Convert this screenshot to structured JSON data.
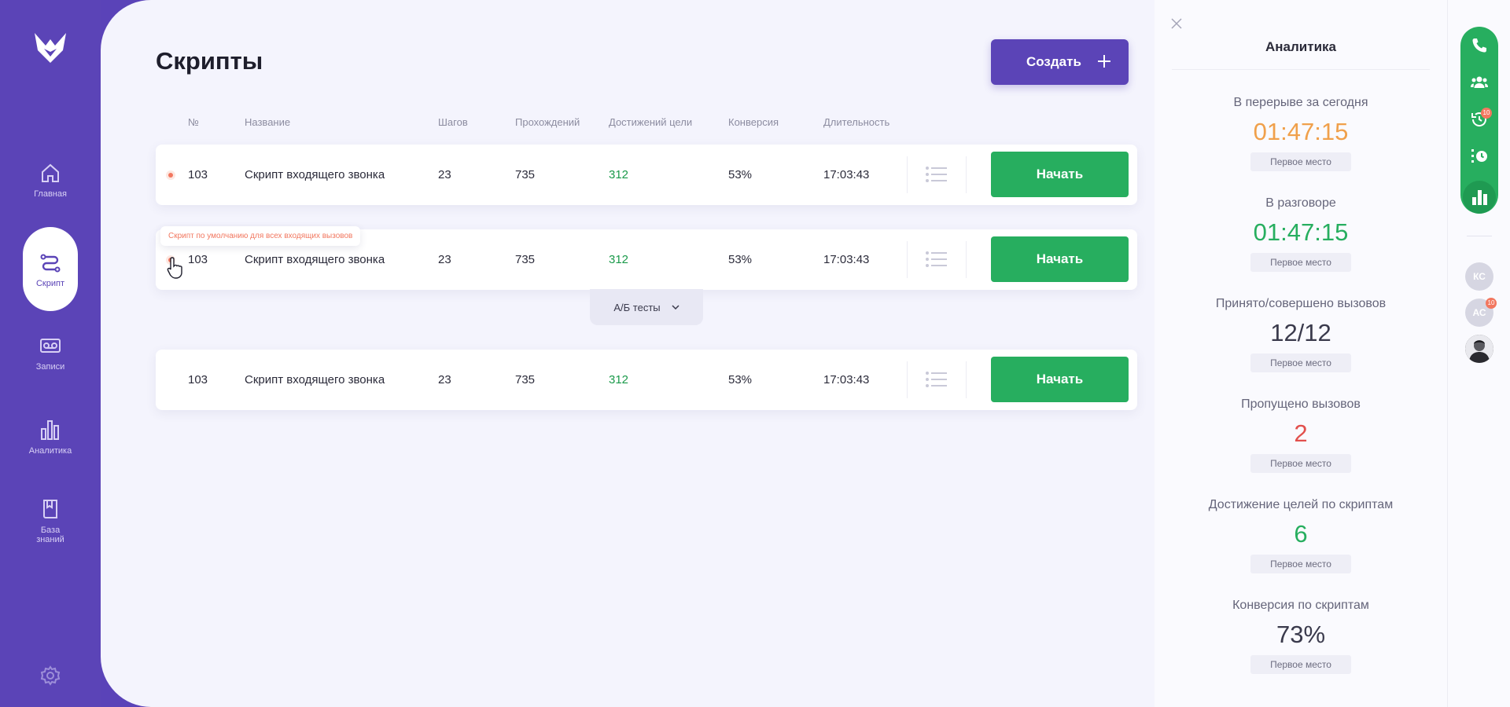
{
  "sidebar": {
    "items": [
      {
        "label": "Главная",
        "icon": "home-icon"
      },
      {
        "label": "Скрипт",
        "icon": "route-icon"
      },
      {
        "label": "Записи",
        "icon": "voicemail-icon"
      },
      {
        "label": "Аналитика",
        "icon": "bar-chart-icon"
      },
      {
        "label": "База знаний",
        "icon": "book-icon"
      }
    ],
    "active": "Скрипт"
  },
  "page": {
    "title": "Скрипты",
    "create_label": "Создать"
  },
  "table": {
    "headers": {
      "num": "№",
      "name": "Название",
      "steps": "Шагов",
      "passes": "Прохождений",
      "goals": "Достижений цели",
      "conversion": "Конверсия",
      "duration": "Длительность"
    },
    "rows": [
      {
        "num": "103",
        "name": "Скрипт входящего звонка",
        "steps": "23",
        "passes": "735",
        "goals": "312",
        "conversion": "53%",
        "duration": "17:03:43",
        "action": "Начать",
        "default": true
      },
      {
        "num": "103",
        "name": "Скрипт входящего звонка",
        "steps": "23",
        "passes": "735",
        "goals": "312",
        "conversion": "53%",
        "duration": "17:03:43",
        "action": "Начать",
        "default": true
      },
      {
        "num": "103",
        "name": "Скрипт входящего звонка",
        "steps": "23",
        "passes": "735",
        "goals": "312",
        "conversion": "53%",
        "duration": "17:03:43",
        "action": "Начать",
        "default": false
      }
    ],
    "tooltip": "Скрипт по умолчанию для всех входящих вызовов",
    "ab_tests_label": "А/Б тесты"
  },
  "analytics": {
    "title": "Аналитика",
    "metrics": [
      {
        "label": "В перерыве за сегодня",
        "value": "01:47:15",
        "place": "Первое место",
        "color": "#f0a04b"
      },
      {
        "label": "В разговоре",
        "value": "01:47:15",
        "place": "Первое место",
        "color": "#27ae5f"
      },
      {
        "label": "Принято/совершено вызовов",
        "value": "12/12",
        "place": "Первое место",
        "color": "#3a3a4c"
      },
      {
        "label": "Пропущено вызовов",
        "value": "2",
        "place": "Первое место",
        "color": "#e2504d"
      },
      {
        "label": "Достижение целей по скриптам",
        "value": "6",
        "place": "Первое место",
        "color": "#27ae5f"
      },
      {
        "label": "Конверсия по скриптам",
        "value": "73%",
        "place": "Первое место",
        "color": "#3a3a4c"
      }
    ]
  },
  "rail": {
    "icons": [
      "phone-icon",
      "team-icon",
      "history-icon",
      "queue-timer-icon",
      "analytics-icon"
    ],
    "history_badge": "10",
    "avatars": [
      {
        "initials": "КС",
        "badge": ""
      },
      {
        "initials": "АС",
        "badge": "10"
      }
    ]
  },
  "colors": {
    "brand": "#5b44b7",
    "success": "#27ae5f",
    "accent": "#f2775f"
  }
}
